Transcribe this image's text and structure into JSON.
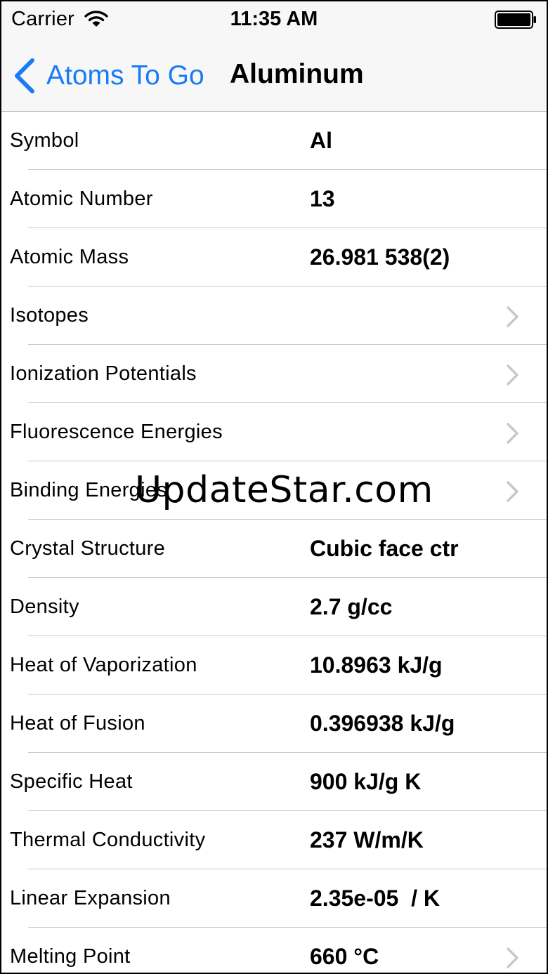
{
  "status_bar": {
    "carrier": "Carrier",
    "time": "11:35 AM",
    "icons": [
      "wifi-icon",
      "battery-icon"
    ]
  },
  "nav": {
    "back_label": "Atoms To Go",
    "title": "Aluminum",
    "accent_color": "#1a7cf5"
  },
  "rows": [
    {
      "label": "Symbol",
      "value": "Al",
      "disclosure": false
    },
    {
      "label": "Atomic Number",
      "value": "13",
      "disclosure": false
    },
    {
      "label": "Atomic Mass",
      "value": "26.981 538(2)",
      "disclosure": false
    },
    {
      "label": "Isotopes",
      "value": "",
      "disclosure": true
    },
    {
      "label": "Ionization Potentials",
      "value": "",
      "disclosure": true
    },
    {
      "label": "Fluorescence Energies",
      "value": "",
      "disclosure": true
    },
    {
      "label": "Binding Energies",
      "value": "",
      "disclosure": true
    },
    {
      "label": "Crystal Structure",
      "value": "Cubic face ctr",
      "disclosure": false
    },
    {
      "label": "Density",
      "value": "2.7 g/cc",
      "disclosure": false
    },
    {
      "label": "Heat of Vaporization",
      "value": "10.8963 kJ/g",
      "disclosure": false
    },
    {
      "label": "Heat of Fusion",
      "value": "0.396938 kJ/g",
      "disclosure": false
    },
    {
      "label": "Specific Heat",
      "value": "900 kJ/g K",
      "disclosure": false
    },
    {
      "label": "Thermal Conductivity",
      "value": "237 W/m/K",
      "disclosure": false
    },
    {
      "label": "Linear Expansion",
      "value": "2.35e-05  / K",
      "disclosure": false
    },
    {
      "label": "Melting Point",
      "value": "660 °C",
      "disclosure": true
    }
  ],
  "watermark": "UpdateStar.com"
}
